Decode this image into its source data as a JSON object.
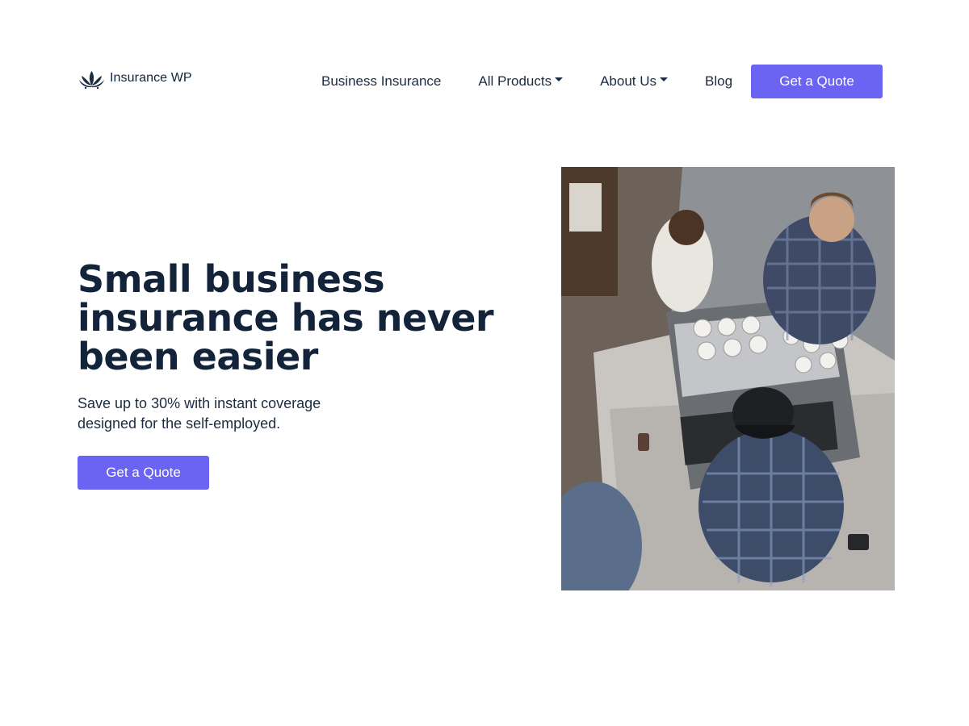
{
  "brand": {
    "name": "Insurance WP",
    "logo_icon": "lotus-icon",
    "accent_color": "#6b63f1",
    "text_color": "#13243a"
  },
  "nav": {
    "items": [
      {
        "label": "Business Insurance",
        "has_dropdown": false
      },
      {
        "label": "All Products",
        "has_dropdown": true
      },
      {
        "label": "About Us",
        "has_dropdown": true
      },
      {
        "label": "Blog",
        "has_dropdown": false
      }
    ],
    "cta_label": "Get a Quote"
  },
  "hero": {
    "title_lines": [
      "Small business",
      "insurance has never",
      "been easier"
    ],
    "subtitle_lines": [
      "Save up to 30% with instant coverage",
      "designed for the self-employed."
    ],
    "cta_label": "Get a Quote"
  }
}
